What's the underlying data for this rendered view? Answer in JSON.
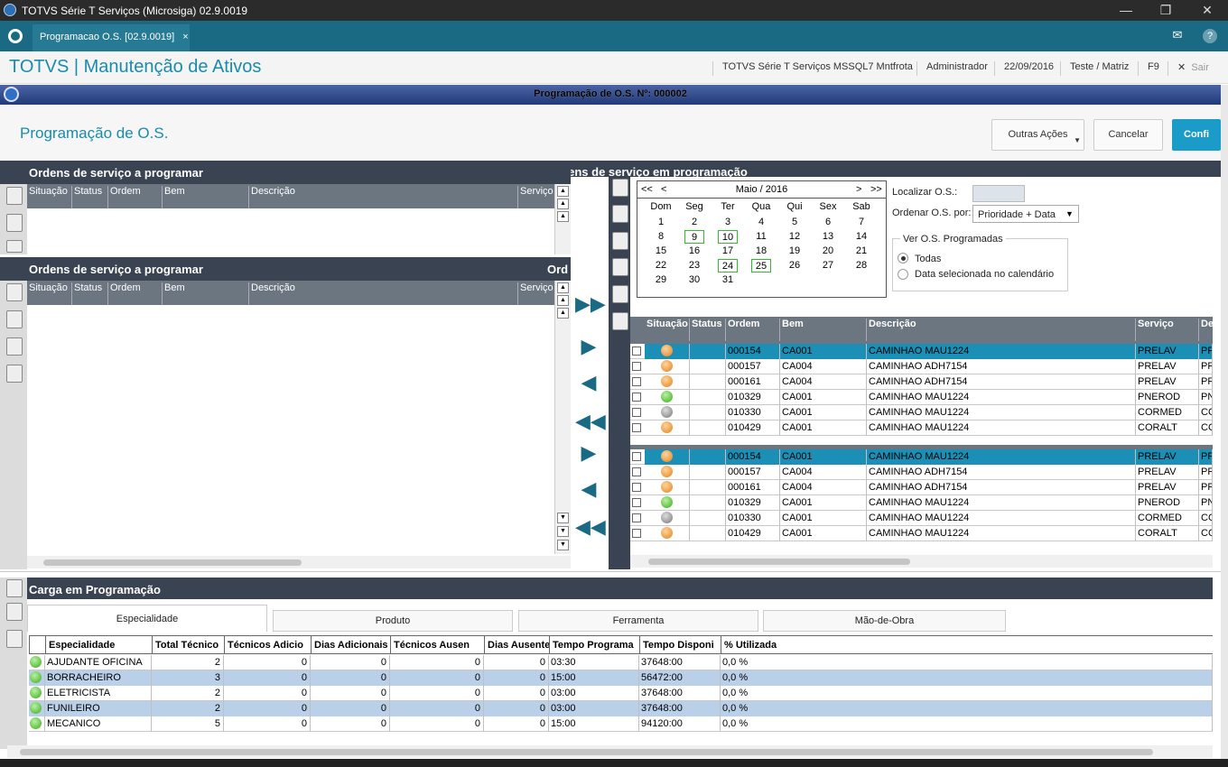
{
  "window": {
    "title": "TOTVS Série T Serviços (Microsiga) 02.9.0019"
  },
  "tab": {
    "label": "Programacao O.S. [02.9.0019]",
    "close": "×"
  },
  "app": {
    "title": "TOTVS | Manutenção de Ativos",
    "env": "TOTVS Série T Serviços MSSQL7 Mntfrota",
    "user": "Administrador",
    "date": "22/09/2016",
    "company": "Teste / Matriz",
    "f9": "F9",
    "exit": "Sair"
  },
  "dialog": {
    "caption": "Programação de O.S. Nº: 000002",
    "title": "Programação de O.S.",
    "other_actions": "Outras Ações",
    "cancel": "Cancelar",
    "confirm": "Confi"
  },
  "left": {
    "section1": "Ordens de serviço a programar",
    "section2": "Ordens de serviço a programar",
    "section2_right": "Ord",
    "columns": [
      "Situação",
      "Status",
      "Ordem",
      "Bem",
      "Descrição",
      "Serviço"
    ]
  },
  "right": {
    "section": "Ordens de serviço em programação",
    "calendar": {
      "nav_prev2": "<<",
      "nav_prev": "<",
      "month": "Maio / 2016",
      "nav_next": ">",
      "nav_next2": ">>",
      "weekdays": [
        "Dom",
        "Seg",
        "Ter",
        "Qua",
        "Qui",
        "Sex",
        "Sab"
      ],
      "weeks": [
        [
          "1",
          "2",
          "3",
          "4",
          "5",
          "6",
          "7"
        ],
        [
          "8",
          "9",
          "10",
          "11",
          "12",
          "13",
          "14"
        ],
        [
          "15",
          "16",
          "17",
          "18",
          "19",
          "20",
          "21"
        ],
        [
          "22",
          "23",
          "24",
          "25",
          "26",
          "27",
          "28"
        ],
        [
          "29",
          "30",
          "31",
          "",
          "",
          "",
          ""
        ]
      ]
    },
    "locate_label": "Localizar O.S.:",
    "order_label": "Ordenar O.S. por:",
    "order_value": "Prioridade + Data",
    "group_label": "Ver O.S. Programadas",
    "opt_all": "Todas",
    "opt_selected": "Data selecionada no calendário",
    "columns": [
      "Situação",
      "Status",
      "Ordem",
      "Bem",
      "Descrição",
      "Serviço",
      "De"
    ],
    "rows": [
      {
        "ordem": "000154",
        "bem": "CA001",
        "desc": "CAMINHAO MAU1224",
        "serv": "PRELAV",
        "de": "PR",
        "dot": "o"
      },
      {
        "ordem": "000157",
        "bem": "CA004",
        "desc": "CAMINHAO ADH7154",
        "serv": "PRELAV",
        "de": "PR",
        "dot": "o"
      },
      {
        "ordem": "000161",
        "bem": "CA004",
        "desc": "CAMINHAO ADH7154",
        "serv": "PRELAV",
        "de": "PR",
        "dot": "o"
      },
      {
        "ordem": "010329",
        "bem": "CA001",
        "desc": "CAMINHAO MAU1224",
        "serv": "PNEROD",
        "de": "PN",
        "dot": "g"
      },
      {
        "ordem": "010330",
        "bem": "CA001",
        "desc": "CAMINHAO MAU1224",
        "serv": "CORMED",
        "de": "CC",
        "dot": "k"
      },
      {
        "ordem": "010429",
        "bem": "CA001",
        "desc": "CAMINHAO MAU1224",
        "serv": "CORALT",
        "de": "CC",
        "dot": "o"
      }
    ]
  },
  "bottom": {
    "section": "Carga em Programação",
    "tabs": [
      "Especialidade",
      "Produto",
      "Ferramenta",
      "Mão-de-Obra"
    ],
    "columns": [
      "Especialidade",
      "Total Técnico",
      "Técnicos Adicio",
      "Dias Adicionais",
      "Técnicos Ausen",
      "Dias Ausente",
      "Tempo Programa",
      "Tempo Disponi",
      "% Utilizada"
    ],
    "rows": [
      [
        "AJUDANTE OFICINA",
        "2",
        "0",
        "0",
        "0",
        "0",
        "03:30",
        "37648:00",
        "0,0 %"
      ],
      [
        "BORRACHEIRO",
        "3",
        "0",
        "0",
        "0",
        "0",
        "15:00",
        "56472:00",
        "0,0 %"
      ],
      [
        "ELETRICISTA",
        "2",
        "0",
        "0",
        "0",
        "0",
        "03:00",
        "37648:00",
        "0,0 %"
      ],
      [
        "FUNILEIRO",
        "2",
        "0",
        "0",
        "0",
        "0",
        "03:00",
        "37648:00",
        "0,0 %"
      ],
      [
        "MECANICO",
        "5",
        "0",
        "0",
        "0",
        "0",
        "15:00",
        "94120:00",
        "0,0 %"
      ]
    ]
  }
}
